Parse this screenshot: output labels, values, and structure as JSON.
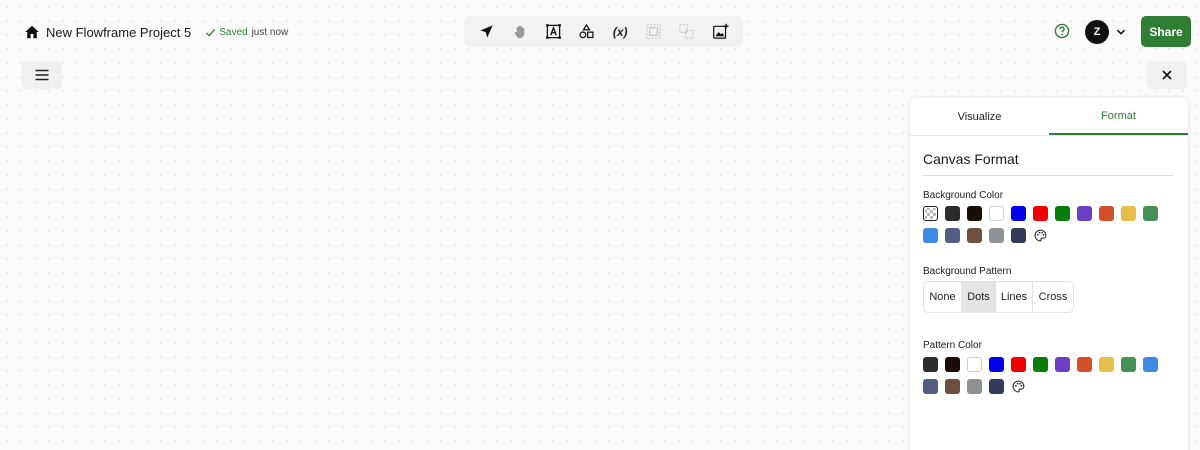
{
  "header": {
    "project_title": "New Flowframe Project 5",
    "saved_label": "Saved",
    "saved_time": "just now"
  },
  "toolbar": {
    "tools": [
      {
        "name": "select-tool",
        "icon": "cursor-arrow-icon",
        "enabled": true
      },
      {
        "name": "pan-tool",
        "icon": "hand-icon",
        "enabled": true
      },
      {
        "name": "text-tool",
        "icon": "text-box-icon",
        "enabled": true
      },
      {
        "name": "shapes-tool",
        "icon": "shapes-icon",
        "enabled": true
      },
      {
        "name": "variable-tool",
        "icon": "variable-icon",
        "label": "(x)",
        "enabled": true
      },
      {
        "name": "group-tool",
        "icon": "group-icon",
        "enabled": false
      },
      {
        "name": "ungroup-tool",
        "icon": "ungroup-icon",
        "enabled": false
      },
      {
        "name": "add-image-tool",
        "icon": "image-plus-icon",
        "enabled": true
      }
    ]
  },
  "user": {
    "avatar_initial": "Z"
  },
  "share_label": "Share",
  "panel": {
    "tabs": [
      {
        "label": "Visualize",
        "active": false
      },
      {
        "label": "Format",
        "active": true
      }
    ],
    "section_title": "Canvas Format",
    "background_color": {
      "label": "Background Color",
      "swatches": [
        "transparent",
        "#2c2c2c",
        "#1a0d08",
        "#ffffff",
        "#0000ee",
        "#ee0000",
        "#087d08",
        "#6c3fc5",
        "#d24f2a",
        "#e8bd48",
        "#449158",
        "#3e8ae0",
        "#525d85",
        "#6e4f40",
        "#8e9295",
        "#323b5c"
      ],
      "selected": "transparent"
    },
    "background_pattern": {
      "label": "Background Pattern",
      "options": [
        "None",
        "Dots",
        "Lines",
        "Cross"
      ],
      "selected": "Dots"
    },
    "pattern_color": {
      "label": "Pattern Color",
      "swatches": [
        "#2c2c2c",
        "#1a0d08",
        "#ffffff",
        "#0000ee",
        "#ee0000",
        "#087d08",
        "#6c3fc5",
        "#d24f2a",
        "#e8bd48",
        "#449158",
        "#3e8ae0",
        "#525d85",
        "#6e4f40",
        "#8e9295",
        "#323b5c"
      ]
    }
  },
  "colors": {
    "accent": "#2e7d32"
  }
}
